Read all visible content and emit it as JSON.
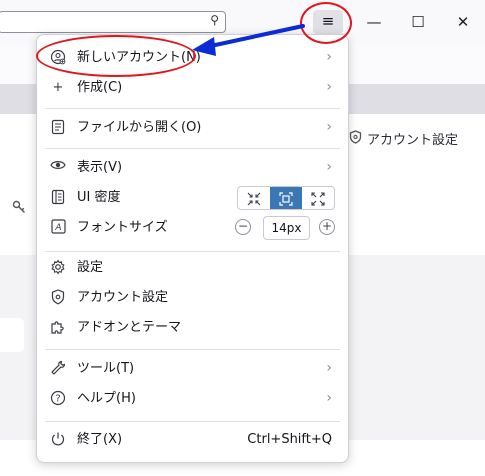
{
  "titlebar": {
    "search_glyph": "⚲",
    "menu_glyph": "≡",
    "minimize_glyph": "—",
    "maximize_glyph": "☐",
    "close_glyph": "✕"
  },
  "background": {
    "account_settings_link": "アカウント設定"
  },
  "menu": {
    "new_account": "新しいアカウント(N)",
    "create": "作成(C)",
    "open_file": "ファイルから開く(O)",
    "view": "表示(V)",
    "ui_density": "UI 密度",
    "font_size": "フォントサイズ",
    "font_size_value": "14px",
    "settings": "設定",
    "account_settings": "アカウント設定",
    "addons_themes": "アドオンとテーマ",
    "tools": "ツール(T)",
    "help": "ヘルプ(H)",
    "quit": "終了(X)",
    "quit_shortcut": "Ctrl+Shift+Q",
    "plus_glyph": "+",
    "minus_glyph": "−",
    "chevron_glyph": "›"
  },
  "density_options": {
    "selected": "normal"
  },
  "colors": {
    "annotation_red": "#e3141b",
    "annotation_arrow_blue": "#0a2bd6",
    "density_selected": "#3a77b3"
  }
}
